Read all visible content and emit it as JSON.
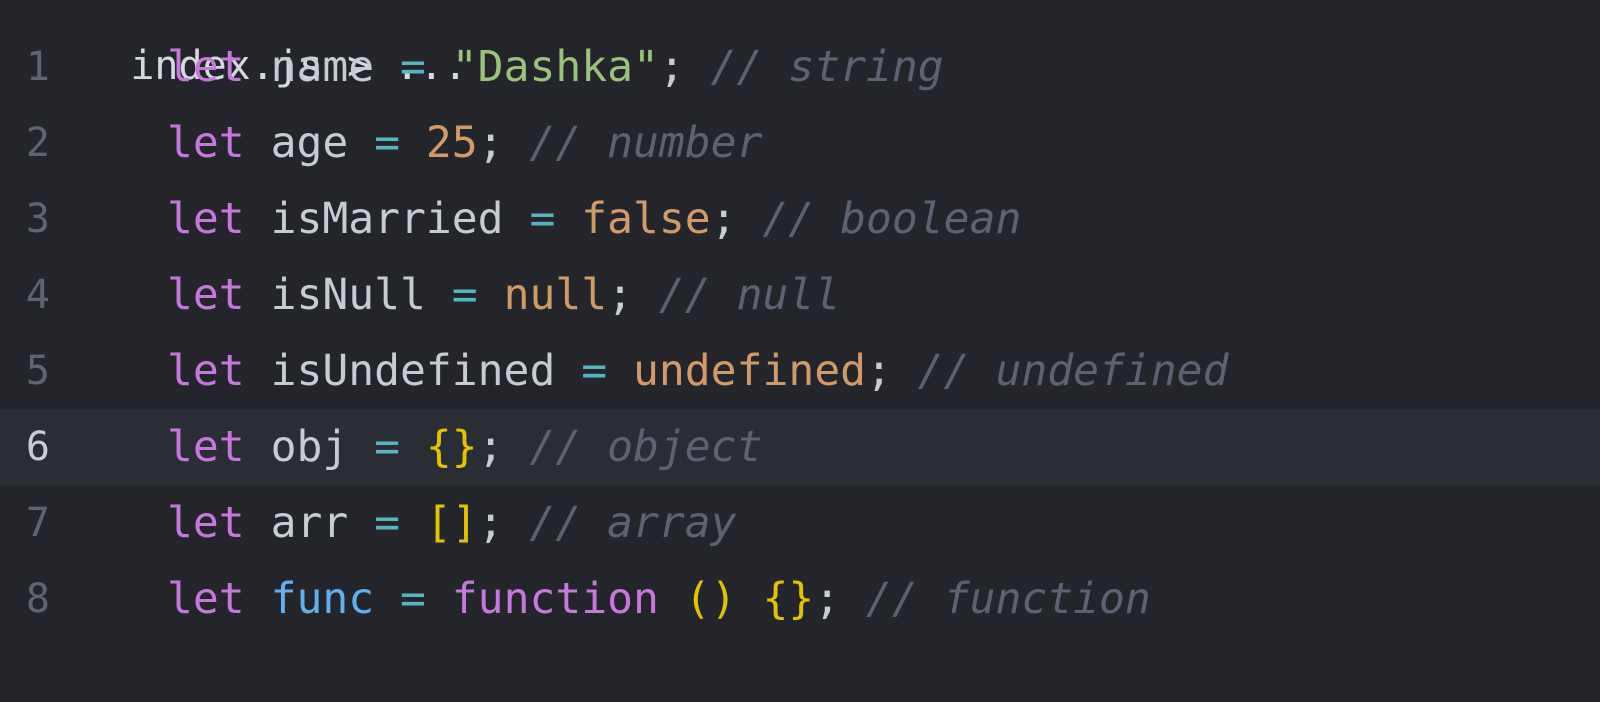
{
  "breadcrumb": {
    "text": "index.js > ..."
  },
  "active_line": 6,
  "lines": [
    {
      "no": "1",
      "tokens": [
        {
          "text": "let",
          "cls": "kw"
        },
        {
          "text": " ",
          "cls": "id"
        },
        {
          "text": "name",
          "cls": "id"
        },
        {
          "text": " = ",
          "cls": "op"
        },
        {
          "text": "\"Dashka\"",
          "cls": "str"
        },
        {
          "text": "; ",
          "cls": "pun"
        },
        {
          "text": "// string",
          "cls": "cm"
        }
      ]
    },
    {
      "no": "2",
      "tokens": [
        {
          "text": "let",
          "cls": "kw"
        },
        {
          "text": " ",
          "cls": "id"
        },
        {
          "text": "age",
          "cls": "id"
        },
        {
          "text": " = ",
          "cls": "op"
        },
        {
          "text": "25",
          "cls": "num"
        },
        {
          "text": "; ",
          "cls": "pun"
        },
        {
          "text": "// number",
          "cls": "cm"
        }
      ]
    },
    {
      "no": "3",
      "tokens": [
        {
          "text": "let",
          "cls": "kw"
        },
        {
          "text": " ",
          "cls": "id"
        },
        {
          "text": "isMarried",
          "cls": "id"
        },
        {
          "text": " = ",
          "cls": "op"
        },
        {
          "text": "false",
          "cls": "num"
        },
        {
          "text": "; ",
          "cls": "pun"
        },
        {
          "text": "// boolean",
          "cls": "cm"
        }
      ]
    },
    {
      "no": "4",
      "tokens": [
        {
          "text": "let",
          "cls": "kw"
        },
        {
          "text": " ",
          "cls": "id"
        },
        {
          "text": "isNull",
          "cls": "id"
        },
        {
          "text": " = ",
          "cls": "op"
        },
        {
          "text": "null",
          "cls": "num"
        },
        {
          "text": "; ",
          "cls": "pun"
        },
        {
          "text": "// null",
          "cls": "cm"
        }
      ]
    },
    {
      "no": "5",
      "tokens": [
        {
          "text": "let",
          "cls": "kw"
        },
        {
          "text": " ",
          "cls": "id"
        },
        {
          "text": "isUndefined",
          "cls": "id"
        },
        {
          "text": " = ",
          "cls": "op"
        },
        {
          "text": "undefined",
          "cls": "num"
        },
        {
          "text": "; ",
          "cls": "pun"
        },
        {
          "text": "// undefined",
          "cls": "cm"
        }
      ]
    },
    {
      "no": "6",
      "tokens": [
        {
          "text": "let",
          "cls": "kw"
        },
        {
          "text": " ",
          "cls": "id"
        },
        {
          "text": "obj",
          "cls": "id"
        },
        {
          "text": " = ",
          "cls": "op"
        },
        {
          "text": "{}",
          "cls": "br"
        },
        {
          "text": "; ",
          "cls": "pun"
        },
        {
          "text": "// object",
          "cls": "cm"
        }
      ]
    },
    {
      "no": "7",
      "tokens": [
        {
          "text": "let",
          "cls": "kw"
        },
        {
          "text": " ",
          "cls": "id"
        },
        {
          "text": "arr",
          "cls": "id"
        },
        {
          "text": " = ",
          "cls": "op"
        },
        {
          "text": "[]",
          "cls": "br"
        },
        {
          "text": "; ",
          "cls": "pun"
        },
        {
          "text": "// array",
          "cls": "cm"
        }
      ]
    },
    {
      "no": "8",
      "tokens": [
        {
          "text": "let",
          "cls": "kw"
        },
        {
          "text": " ",
          "cls": "id"
        },
        {
          "text": "func",
          "cls": "fn"
        },
        {
          "text": " = ",
          "cls": "op"
        },
        {
          "text": "function",
          "cls": "kw"
        },
        {
          "text": " ",
          "cls": "id"
        },
        {
          "text": "()",
          "cls": "br"
        },
        {
          "text": " ",
          "cls": "id"
        },
        {
          "text": "{}",
          "cls": "br"
        },
        {
          "text": "; ",
          "cls": "pun"
        },
        {
          "text": "// function",
          "cls": "cm"
        }
      ]
    }
  ]
}
